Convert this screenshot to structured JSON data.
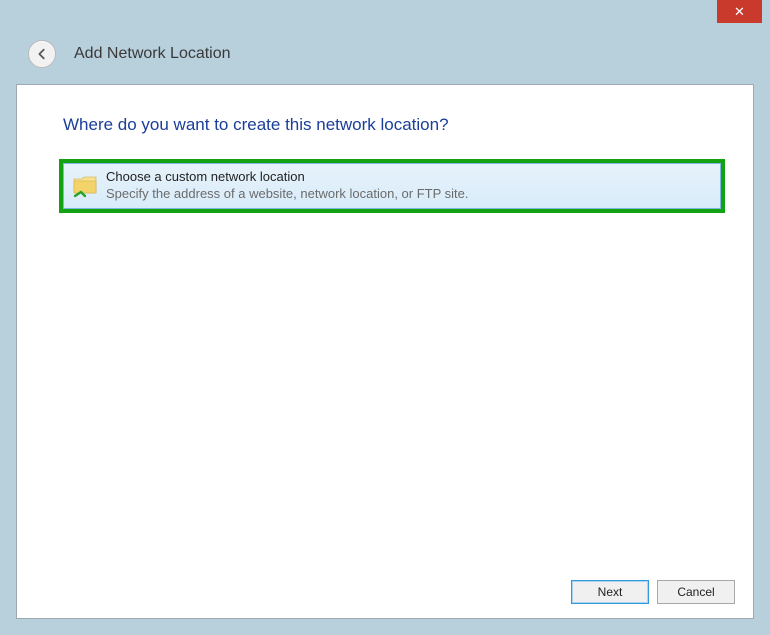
{
  "window": {
    "title": "Add Network Location",
    "close_glyph": "✕"
  },
  "main": {
    "prompt": "Where do you want to create this network location?",
    "option": {
      "title": "Choose a custom network location",
      "description": "Specify the address of a website, network location, or FTP site."
    }
  },
  "buttons": {
    "next": "Next",
    "cancel": "Cancel"
  }
}
